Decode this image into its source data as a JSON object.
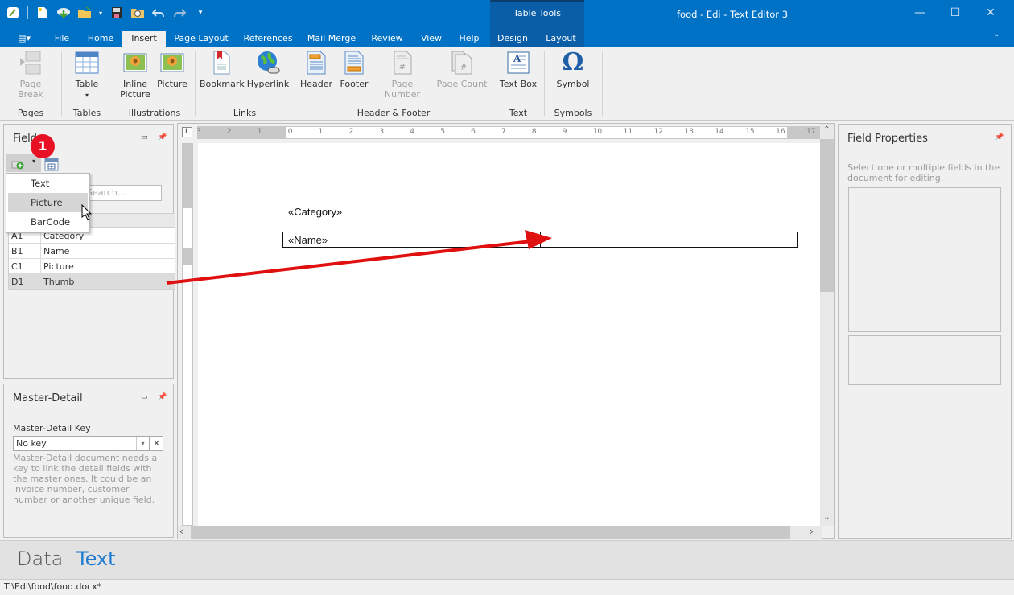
{
  "window": {
    "title": "food - Edi - Text Editor 3",
    "contextual_group": "Table Tools",
    "controls": {
      "minimize": "—",
      "maximize": "☐",
      "close": "✕"
    }
  },
  "quick_access": [
    "app-icon",
    "new-doc-icon",
    "download-icon",
    "open-folder-icon",
    "save-icon",
    "preview-icon",
    "undo-icon",
    "redo-icon",
    "customize-icon"
  ],
  "tabs": [
    "File",
    "Home",
    "Insert",
    "Page Layout",
    "References",
    "Mail Merge",
    "Review",
    "View",
    "Help",
    "Design",
    "Layout"
  ],
  "active_tab": "Insert",
  "ribbon": {
    "buttons": {
      "page_break": "Page Break",
      "table": "Table",
      "inline_picture_1": "Inline",
      "inline_picture_2": "Picture",
      "picture": "Picture",
      "bookmark": "Bookmark",
      "hyperlink": "Hyperlink",
      "header": "Header",
      "footer": "Footer",
      "page_number": "Page Number",
      "page_count": "Page Count",
      "text_box": "Text Box",
      "symbol": "Symbol"
    },
    "groups": {
      "pages": "Pages",
      "tables": "Tables",
      "illustrations": "Illustrations",
      "links": "Links",
      "header_footer": "Header & Footer",
      "text": "Text",
      "symbols": "Symbols"
    }
  },
  "fields_panel": {
    "title": "Fields",
    "search_placeholder": "Search...",
    "badge": "1",
    "dropdown": [
      "Text",
      "Picture",
      "BarCode"
    ],
    "highlighted_option": "Picture",
    "rows": [
      {
        "id": "A1",
        "name": "Category"
      },
      {
        "id": "B1",
        "name": "Name"
      },
      {
        "id": "C1",
        "name": "Picture"
      },
      {
        "id": "D1",
        "name": "Thumb"
      }
    ],
    "selected_row": "D1"
  },
  "master_detail": {
    "title": "Master-Detail",
    "key_label": "Master-Detail Key",
    "key_value": "No key",
    "help": "Master-Detail document needs a key to link the detail fields with the master ones. It could be an invoice number, customer number or another unique field."
  },
  "field_properties": {
    "title": "Field Properties",
    "hint": "Select one or multiple fields in the document for editing."
  },
  "document": {
    "category_field": "«Category»",
    "name_field": "«Name»",
    "ruler_labels": [
      "3",
      "2",
      "1",
      "0",
      "1",
      "2",
      "3",
      "4",
      "5",
      "6",
      "7",
      "8",
      "9",
      "10",
      "11",
      "12",
      "13",
      "14",
      "15",
      "16",
      "17"
    ]
  },
  "bottom_nav": {
    "data": "Data",
    "text": "Text",
    "active": "Text"
  },
  "status": {
    "path": "T:\\Edi\\food\\food.docx*"
  },
  "colors": {
    "titlebar": "#0072c6",
    "accent_text": "#1e7bd0",
    "badge": "#e81123",
    "arrow": "#e01010"
  }
}
